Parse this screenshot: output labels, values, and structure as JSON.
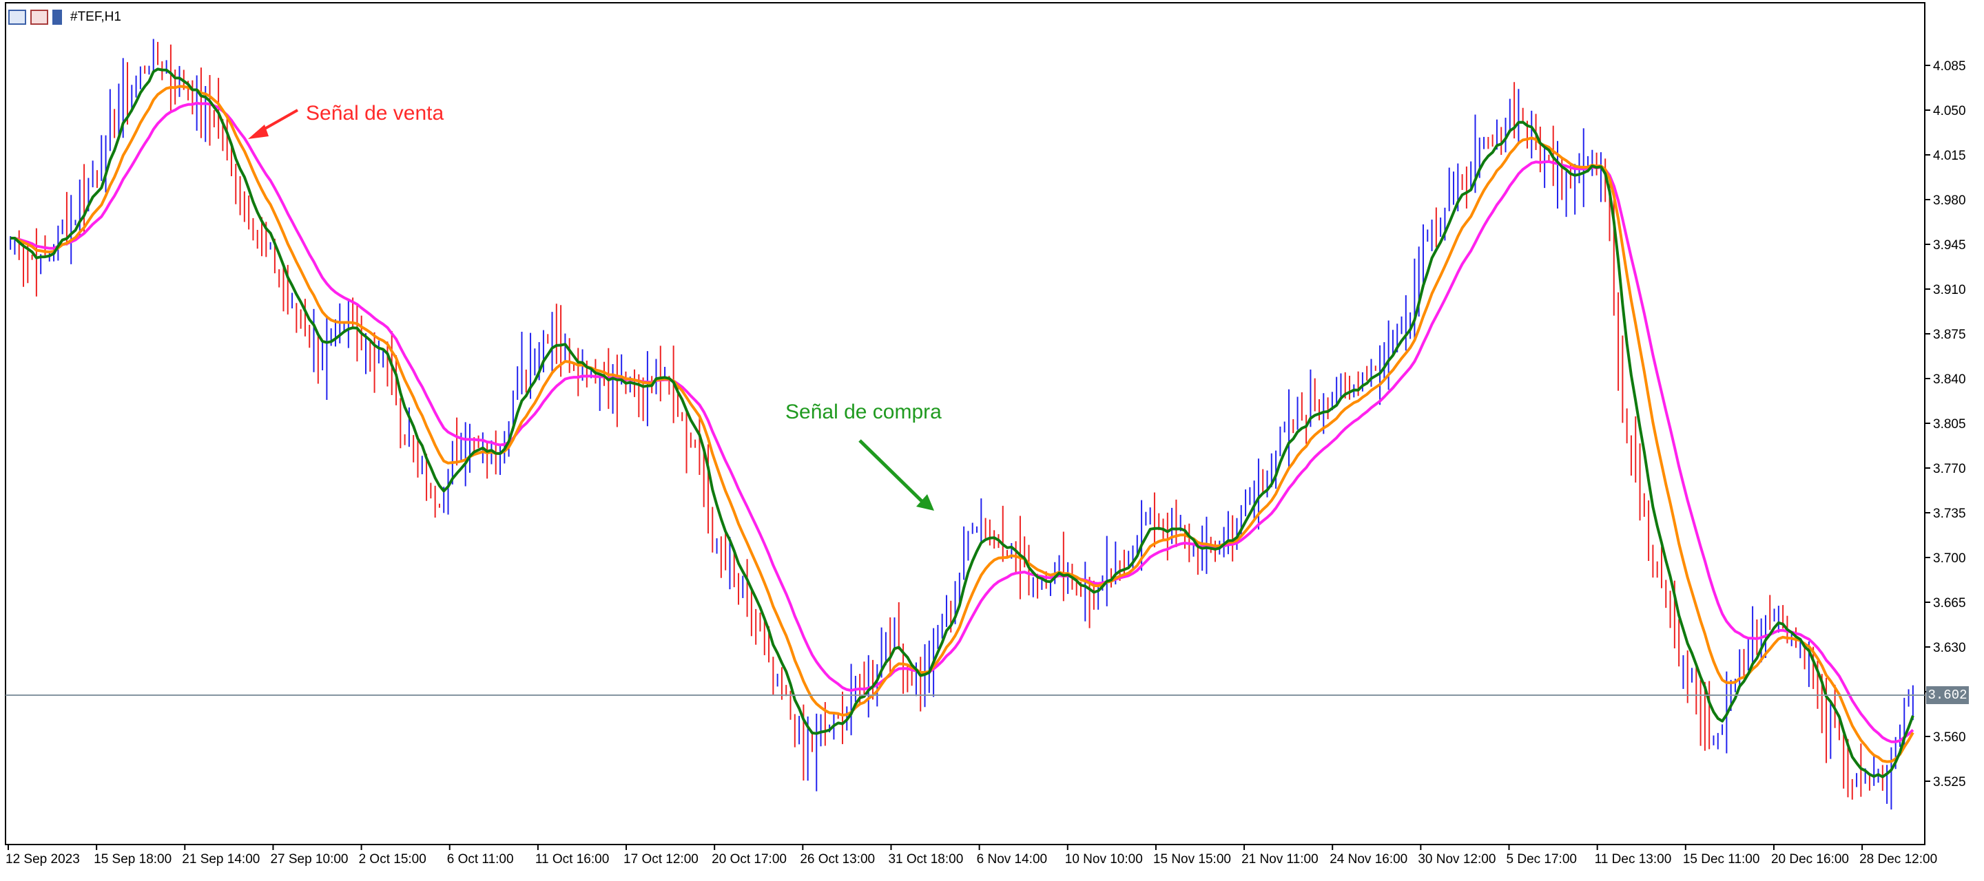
{
  "chart_window": {
    "symbol_title": "#TEF,H1",
    "icons": [
      "chart-window-icon",
      "chart-type-icon",
      "chart-color-icon"
    ]
  },
  "annotations": {
    "sell_signal": "Señal de venta",
    "buy_signal": "Señal de compra",
    "sell_color": "#ff2a2a",
    "buy_color": "#1f9a1f"
  },
  "price_axis": {
    "ticks": [
      "4.085",
      "4.050",
      "4.015",
      "3.980",
      "3.945",
      "3.910",
      "3.875",
      "3.840",
      "3.805",
      "3.770",
      "3.735",
      "3.700",
      "3.665",
      "3.630",
      "3.595",
      "3.560",
      "3.525"
    ],
    "current_price": "3.602"
  },
  "time_axis": {
    "ticks": [
      "12 Sep 2023",
      "15 Sep 18:00",
      "21 Sep 14:00",
      "27 Sep 10:00",
      "2 Oct 15:00",
      "6 Oct 11:00",
      "11 Oct 16:00",
      "17 Oct 12:00",
      "20 Oct 17:00",
      "26 Oct 13:00",
      "31 Oct 18:00",
      "6 Nov 14:00",
      "10 Nov 10:00",
      "15 Nov 15:00",
      "21 Nov 11:00",
      "24 Nov 16:00",
      "30 Nov 12:00",
      "5 Dec 17:00",
      "11 Dec 13:00",
      "15 Dec 11:00",
      "20 Dec 16:00",
      "28 Dec 12:00"
    ]
  },
  "colors": {
    "bull_bar": "#2222ee",
    "bear_bar": "#ee2222",
    "ma_fast": "#0f7a0f",
    "ma_mid": "#ff8c00",
    "ma_slow": "#ff22ee",
    "price_line": "#8494a0",
    "axis": "#000000"
  },
  "chart_data": {
    "type": "line",
    "title": "#TEF,H1",
    "y_range": [
      3.49,
      4.12
    ],
    "price_anchors": [
      {
        "x": "12 Sep 2023",
        "y": 3.95
      },
      {
        "x": "13 Sep",
        "y": 3.93
      },
      {
        "x": "14 Sep",
        "y": 3.96
      },
      {
        "x": "15 Sep 18:00",
        "y": 4.0
      },
      {
        "x": "18 Sep",
        "y": 4.06
      },
      {
        "x": "19 Sep",
        "y": 4.09
      },
      {
        "x": "20 Sep",
        "y": 4.07
      },
      {
        "x": "21 Sep 14:00",
        "y": 4.05
      },
      {
        "x": "22 Sep",
        "y": 3.99
      },
      {
        "x": "25 Sep",
        "y": 3.94
      },
      {
        "x": "27 Sep 10:00",
        "y": 3.89
      },
      {
        "x": "28 Sep",
        "y": 3.86
      },
      {
        "x": "29 Sep",
        "y": 3.88
      },
      {
        "x": "2 Oct 15:00",
        "y": 3.86
      },
      {
        "x": "3 Oct",
        "y": 3.79
      },
      {
        "x": "4 Oct",
        "y": 3.74
      },
      {
        "x": "5 Oct",
        "y": 3.79
      },
      {
        "x": "6 Oct 11:00",
        "y": 3.78
      },
      {
        "x": "9 Oct",
        "y": 3.84
      },
      {
        "x": "10 Oct",
        "y": 3.88
      },
      {
        "x": "11 Oct 16:00",
        "y": 3.85
      },
      {
        "x": "13 Oct",
        "y": 3.84
      },
      {
        "x": "16 Oct",
        "y": 3.83
      },
      {
        "x": "17 Oct 12:00",
        "y": 3.85
      },
      {
        "x": "18 Oct",
        "y": 3.79
      },
      {
        "x": "19 Oct",
        "y": 3.7
      },
      {
        "x": "20 Oct 17:00",
        "y": 3.66
      },
      {
        "x": "23 Oct",
        "y": 3.6
      },
      {
        "x": "24 Oct",
        "y": 3.55
      },
      {
        "x": "25 Oct",
        "y": 3.57
      },
      {
        "x": "26 Oct 13:00",
        "y": 3.6
      },
      {
        "x": "27 Oct",
        "y": 3.64
      },
      {
        "x": "30 Oct",
        "y": 3.6
      },
      {
        "x": "31 Oct 18:00",
        "y": 3.66
      },
      {
        "x": "1 Nov",
        "y": 3.73
      },
      {
        "x": "2 Nov",
        "y": 3.71
      },
      {
        "x": "3 Nov",
        "y": 3.68
      },
      {
        "x": "6 Nov 14:00",
        "y": 3.69
      },
      {
        "x": "7 Nov",
        "y": 3.67
      },
      {
        "x": "8 Nov",
        "y": 3.69
      },
      {
        "x": "10 Nov 10:00",
        "y": 3.73
      },
      {
        "x": "13 Nov",
        "y": 3.72
      },
      {
        "x": "14 Nov",
        "y": 3.7
      },
      {
        "x": "15 Nov 15:00",
        "y": 3.72
      },
      {
        "x": "17 Nov",
        "y": 3.76
      },
      {
        "x": "20 Nov",
        "y": 3.8
      },
      {
        "x": "21 Nov 11:00",
        "y": 3.82
      },
      {
        "x": "22 Nov",
        "y": 3.83
      },
      {
        "x": "24 Nov 16:00",
        "y": 3.85
      },
      {
        "x": "27 Nov",
        "y": 3.88
      },
      {
        "x": "28 Nov",
        "y": 3.96
      },
      {
        "x": "30 Nov 12:00",
        "y": 3.99
      },
      {
        "x": "1 Dec",
        "y": 4.02
      },
      {
        "x": "5 Dec 17:00",
        "y": 4.05
      },
      {
        "x": "6 Dec",
        "y": 4.01
      },
      {
        "x": "8 Dec",
        "y": 4.0
      },
      {
        "x": "11 Dec 13:00",
        "y": 4.01
      },
      {
        "x": "12 Dec",
        "y": 3.79
      },
      {
        "x": "13 Dec",
        "y": 3.68
      },
      {
        "x": "14 Dec",
        "y": 3.61
      },
      {
        "x": "15 Dec 11:00",
        "y": 3.56
      },
      {
        "x": "18 Dec",
        "y": 3.62
      },
      {
        "x": "19 Dec",
        "y": 3.66
      },
      {
        "x": "20 Dec 16:00",
        "y": 3.63
      },
      {
        "x": "22 Dec",
        "y": 3.57
      },
      {
        "x": "27 Dec",
        "y": 3.52
      },
      {
        "x": "28 Dec 12:00",
        "y": 3.53
      },
      {
        "x": "29 Dec",
        "y": 3.6
      }
    ]
  }
}
